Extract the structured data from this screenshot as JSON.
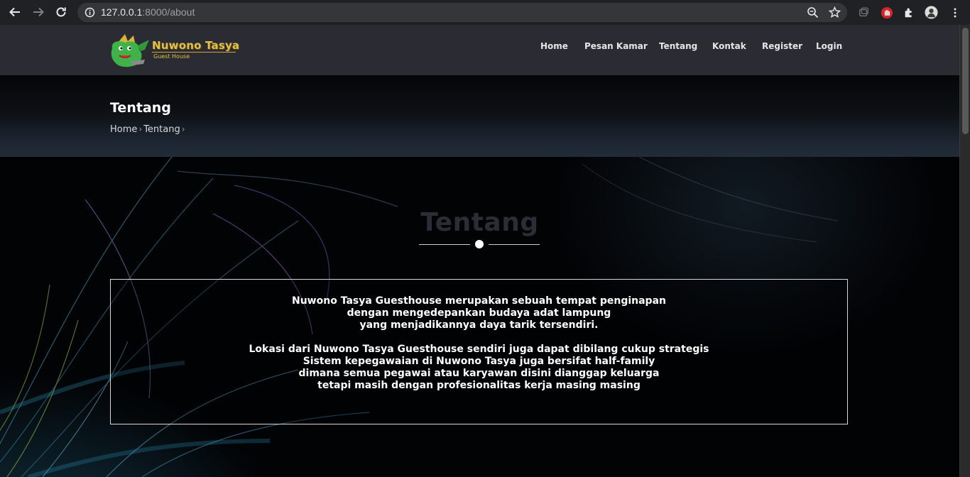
{
  "browser": {
    "url_host": "127.0.0.1",
    "url_path": ":8000/about"
  },
  "site": {
    "brand": "Nuwono Tasya",
    "tagline": "Guest House",
    "menu": [
      {
        "label": "Home"
      },
      {
        "label": "Pesan Kamar"
      },
      {
        "label": "Tentang"
      },
      {
        "label": "Kontak"
      },
      {
        "label": "Register"
      },
      {
        "label": "Login"
      }
    ]
  },
  "banner": {
    "title": "Tentang",
    "breadcrumb": [
      "Home",
      "Tentang"
    ]
  },
  "section": {
    "title": "Tentang"
  },
  "about": {
    "paragraph1": [
      "Nuwono Tasya Guesthouse merupakan sebuah tempat penginapan",
      "dengan mengedepankan budaya adat lampung",
      "yang menjadikannya daya tarik tersendiri."
    ],
    "paragraph2": [
      "Lokasi dari Nuwono Tasya Guesthouse sendiri juga dapat dibilang cukup strategis",
      "Sistem kepegawaian di Nuwono Tasya juga bersifat half-family",
      "dimana semua pegawai atau karyawan disini dianggap keluarga",
      "tetapi masih dengan profesionalitas kerja masing masing"
    ]
  },
  "colors": {
    "navbar": "#2b2c33",
    "brand_gold": "#e0c24a",
    "section_title": "#2a2d35"
  }
}
